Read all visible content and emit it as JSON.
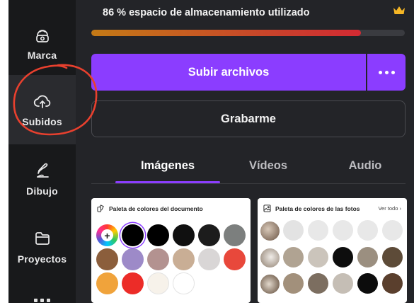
{
  "sidebar": {
    "items": [
      {
        "label": "Marca",
        "icon": "brand-kit-icon"
      },
      {
        "label": "Subidos",
        "icon": "cloud-upload-icon",
        "active": true
      },
      {
        "label": "Dibujo",
        "icon": "draw-icon"
      },
      {
        "label": "Proyectos",
        "icon": "folder-icon"
      }
    ],
    "more_icon": "more-apps-icon"
  },
  "storage": {
    "text": "86 % espacio de almacenamiento utilizado",
    "percent": 86,
    "icon": "crown-icon"
  },
  "upload": {
    "label": "Subir archivos",
    "more_icon": "more-options-icon"
  },
  "record": {
    "label": "Grabarme"
  },
  "tabs": [
    {
      "label": "Imágenes",
      "active": true
    },
    {
      "label": "Vídeos"
    },
    {
      "label": "Audio"
    }
  ],
  "doc_palette": {
    "title": "Paleta de colores del documento",
    "colors": [
      [
        "#000000",
        "#000000",
        "#101010",
        "#1c1c1c",
        "#7c7f7e"
      ],
      [
        "#8b5e3c",
        "#9d8ac8",
        "#b39290",
        "#c9ae95",
        "#d9d6d6",
        "#e8483b"
      ],
      [
        "#f0a33b",
        "#ec2c28",
        "#f7f2ea",
        "#ffffff"
      ]
    ]
  },
  "photo_palette": {
    "title": "Paleta de colores de las fotos",
    "link": "Ver todo",
    "rows": [
      [
        "#e3e3e3",
        "#e8e8e8",
        "#e8e8e8",
        "#e8e8e8",
        "#e8e8e8"
      ],
      [
        "#b0a392",
        "#cbc4bb",
        "#0d0d0d",
        "#9b8f80",
        "#5d4b38"
      ],
      [
        "#a2907b",
        "#7c6e60",
        "#c5beb5",
        "#0c0c0c",
        "#5a3f2d"
      ]
    ]
  },
  "colors": {
    "accent": "#8b3dff",
    "annotation": "#e8402e",
    "panel": "#232428",
    "sidebar": "#18191b"
  }
}
